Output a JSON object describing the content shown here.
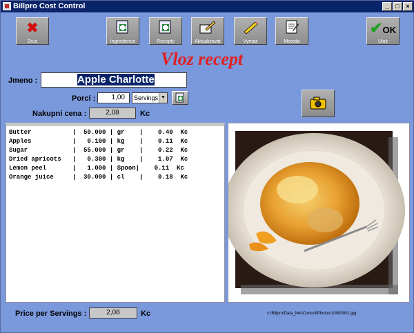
{
  "window": {
    "title": "Billpro Cost Control"
  },
  "toolbar": [
    {
      "name": "cancel-button",
      "icon": "red-x-icon",
      "label": "Zrus"
    },
    {
      "name": "ingredients-button",
      "icon": "add-document-icon",
      "label": "Ingredience"
    },
    {
      "name": "recipes-button",
      "icon": "add-document-icon",
      "label": "Recepty"
    },
    {
      "name": "update-button",
      "icon": "pencil-hand-icon",
      "label": "Aktualizovat"
    },
    {
      "name": "print-button",
      "icon": "pencil-icon",
      "label": "Vymaz"
    },
    {
      "name": "method-button",
      "icon": "notepad-icon",
      "label": "Metoda"
    },
    {
      "name": "ok-button",
      "icon": "green-check-icon",
      "label": "Ulož",
      "glyph_text": "OK"
    }
  ],
  "heading": "Vloz recept",
  "form": {
    "name_label": "Jmeno :",
    "name_value": "Apple Charlotte",
    "portions_label": "Porcí :",
    "portions_value": "1,00",
    "unit_value": "Servings",
    "purchase_label": "Nakupni cena :",
    "purchase_value": "2,08",
    "purchase_currency": "Kc"
  },
  "ingredients": [
    "Butter           |  50.000 | gr    |    0.40  Kc",
    "Apples           |   0.100 | kg    |    0.11  Kc",
    "Sugar            |  55.000 | gr    |    0.22  Kc",
    "Dried apricots   |   0.300 | kg    |    1.07  Kc",
    "Lemon peel       |   1.000 | Spoon|    0.11  Kc",
    "Orange juice     |  30.000 | cl    |    0.18  Kc"
  ],
  "footer": {
    "price_label": "Price per Servings :",
    "price_value": "2,08",
    "price_currency": "Kc",
    "photo_path": "c:\\Billpro\\Data_Net\\Control\\Photos\\10000001.jpg"
  },
  "colors": {
    "background": "#7a98dc",
    "heading": "#e02020",
    "selection": "#0a246a"
  }
}
